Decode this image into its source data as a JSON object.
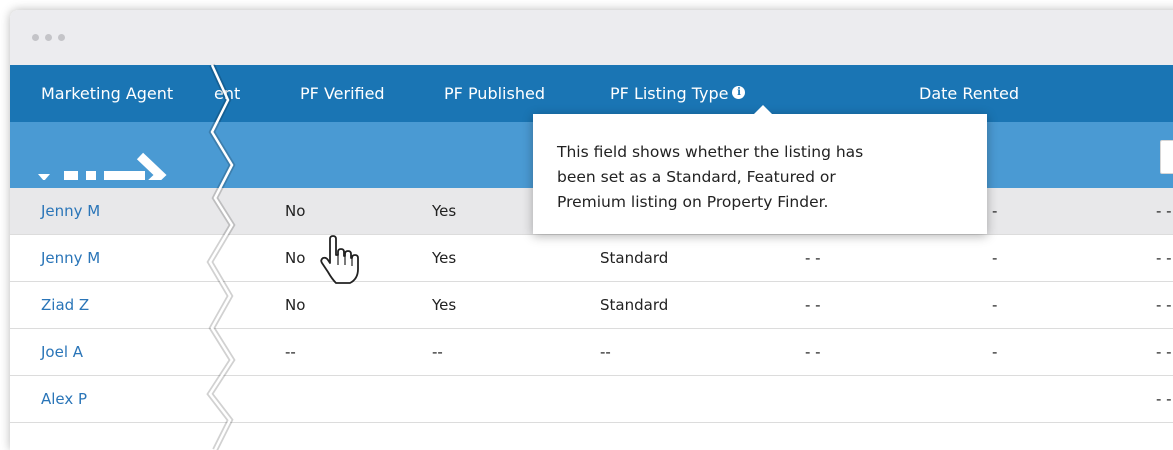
{
  "window": {
    "titlebar_dots": [
      "dot",
      "dot",
      "dot"
    ]
  },
  "table": {
    "headers": {
      "marketing_agent": "Marketing Agent",
      "cut_fragment": "ent",
      "pf_verified": "PF Verified",
      "pf_published": "PF Published",
      "pf_listing_type": "PF Listing Type",
      "date_rented": "Date Rented"
    },
    "rows": [
      {
        "agent": "Jenny M",
        "verified": "No",
        "published": "Yes",
        "listing_type": "",
        "c1": "",
        "c2": "-",
        "c3": "- -"
      },
      {
        "agent": "Jenny M",
        "verified": "No",
        "published": "Yes",
        "listing_type": "Standard",
        "c1": "- -",
        "c2": "-",
        "c3": "- -"
      },
      {
        "agent": "Ziad Z",
        "verified": "No",
        "published": "Yes",
        "listing_type": "Standard",
        "c1": "- -",
        "c2": "-",
        "c3": "- -"
      },
      {
        "agent": "Joel A",
        "verified": "--",
        "published": "--",
        "listing_type": "--",
        "c1": "- -",
        "c2": "-",
        "c3": "- -"
      },
      {
        "agent": "Alex P",
        "verified": "",
        "published": "",
        "listing_type": "",
        "c1": "",
        "c2": "",
        "c3": "- -"
      }
    ]
  },
  "tooltip": {
    "line1": "This field shows whether the listing has",
    "line2": "been set as a Standard, Featured or",
    "line3": "Premium listing on Property Finder."
  },
  "icons": {
    "info": "info-icon",
    "filter_toggle": "chevron-down-icon",
    "arrow": "dashed-arrow-icon",
    "cursor": "hand-pointer-icon"
  },
  "colors": {
    "header": "#1a75b4",
    "filter_bar": "#4a9ad3",
    "link": "#2a75b8",
    "row_highlight": "#e8e8ea"
  }
}
